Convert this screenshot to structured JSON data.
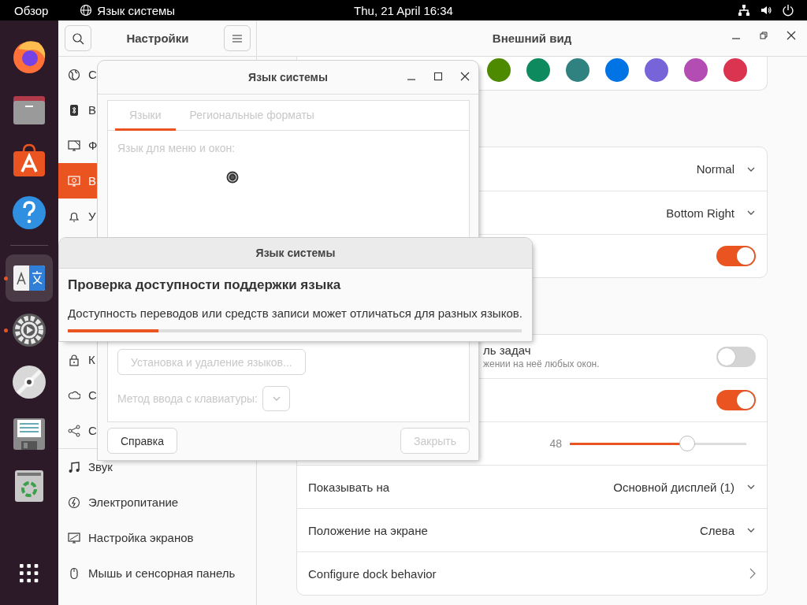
{
  "top_bar": {
    "activities": "Обзор",
    "app_name": "Язык системы",
    "clock": "Thu, 21 April 16:34"
  },
  "dock": {
    "items": [
      {
        "kind": "browser",
        "running": false,
        "selected": false
      },
      {
        "kind": "files",
        "running": false,
        "selected": false
      },
      {
        "kind": "store",
        "running": false,
        "selected": false
      },
      {
        "kind": "help",
        "running": false,
        "selected": false
      },
      {
        "kind": "language",
        "running": true,
        "selected": true
      },
      {
        "kind": "settings",
        "running": true,
        "selected": false
      },
      {
        "kind": "disc",
        "running": false,
        "selected": false
      },
      {
        "kind": "save",
        "running": false,
        "selected": false
      },
      {
        "kind": "trash",
        "running": false,
        "selected": false
      },
      {
        "kind": "apps",
        "running": false,
        "selected": false
      }
    ]
  },
  "settings": {
    "title": "Настройки",
    "page_title": "Внешний вид",
    "sidebar": {
      "groups": [
        {
          "items": [
            {
              "kind": "network",
              "label": "С",
              "selected": false
            },
            {
              "kind": "bluetooth",
              "label": "В",
              "selected": false
            },
            {
              "kind": "background",
              "label": "Ф",
              "selected": false
            },
            {
              "kind": "appearance",
              "label": "В",
              "selected": true
            },
            {
              "kind": "notifications",
              "label": "У",
              "selected": false
            }
          ]
        },
        {
          "items": [
            {
              "kind": "privacy",
              "label": "К",
              "selected": false
            },
            {
              "kind": "accounts",
              "label": "С",
              "selected": false
            },
            {
              "kind": "sharing",
              "label": "С",
              "selected": false
            }
          ]
        },
        {
          "items": [
            {
              "kind": "sound",
              "label": "Звук",
              "selected": false
            },
            {
              "kind": "power",
              "label": "Электропитание",
              "selected": false
            },
            {
              "kind": "displays",
              "label": "Настройка экранов",
              "selected": false
            },
            {
              "kind": "mouse",
              "label": "Мышь и сенсорная панель",
              "selected": false
            }
          ]
        }
      ]
    },
    "accent_colors": [
      {
        "color": "#4e8a00"
      },
      {
        "color": "#0e8a5f"
      },
      {
        "color": "#308280"
      },
      {
        "color": "#0073e5"
      },
      {
        "color": "#7764d8"
      },
      {
        "color": "#b34cb3"
      },
      {
        "color": "#da3450"
      }
    ],
    "cards": [
      {
        "rows": [
          {
            "kind": "dropdown",
            "value": "Normal"
          },
          {
            "kind": "dropdown",
            "value": "Bottom Right"
          },
          {
            "kind": "switch",
            "on": true
          }
        ]
      },
      {
        "rows": [
          {
            "kind": "switch",
            "partial": true,
            "title": "ль задач",
            "subtitle": "жении на неё любых окон.",
            "on": false
          },
          {
            "kind": "switch",
            "on": true
          },
          {
            "kind": "slider",
            "reading": "48",
            "level": 0.665
          },
          {
            "kind": "dropdown",
            "title": "Показывать на",
            "value": "Основной дисплей (1)"
          },
          {
            "kind": "dropdown",
            "title": "Положение на экране",
            "value": "Слева"
          },
          {
            "kind": "link",
            "title": "Configure dock behavior"
          }
        ]
      }
    ]
  },
  "language_window": {
    "title": "Язык системы",
    "content_disabled": true,
    "tabs": [
      {
        "label": "Языки",
        "selected": true
      },
      {
        "label": "Региональные форматы",
        "selected": false
      }
    ],
    "menu_language_label": "Язык для меню и окон:",
    "busy": true,
    "install_button": {
      "label": "Установка и удаление языков...",
      "disabled": true
    },
    "input_method_label": "Метод ввода с клавиатуры:",
    "input_method_disabled": true,
    "help_button": {
      "label": "Справка",
      "disabled": false
    },
    "close_button": {
      "label": "Закрыть",
      "disabled": true
    }
  },
  "progress_dialog": {
    "title": "Язык системы",
    "heading": "Проверка доступности поддержки языка",
    "message": "Доступность переводов или средств записи может отличаться для разных языков.",
    "level": 0.2
  }
}
